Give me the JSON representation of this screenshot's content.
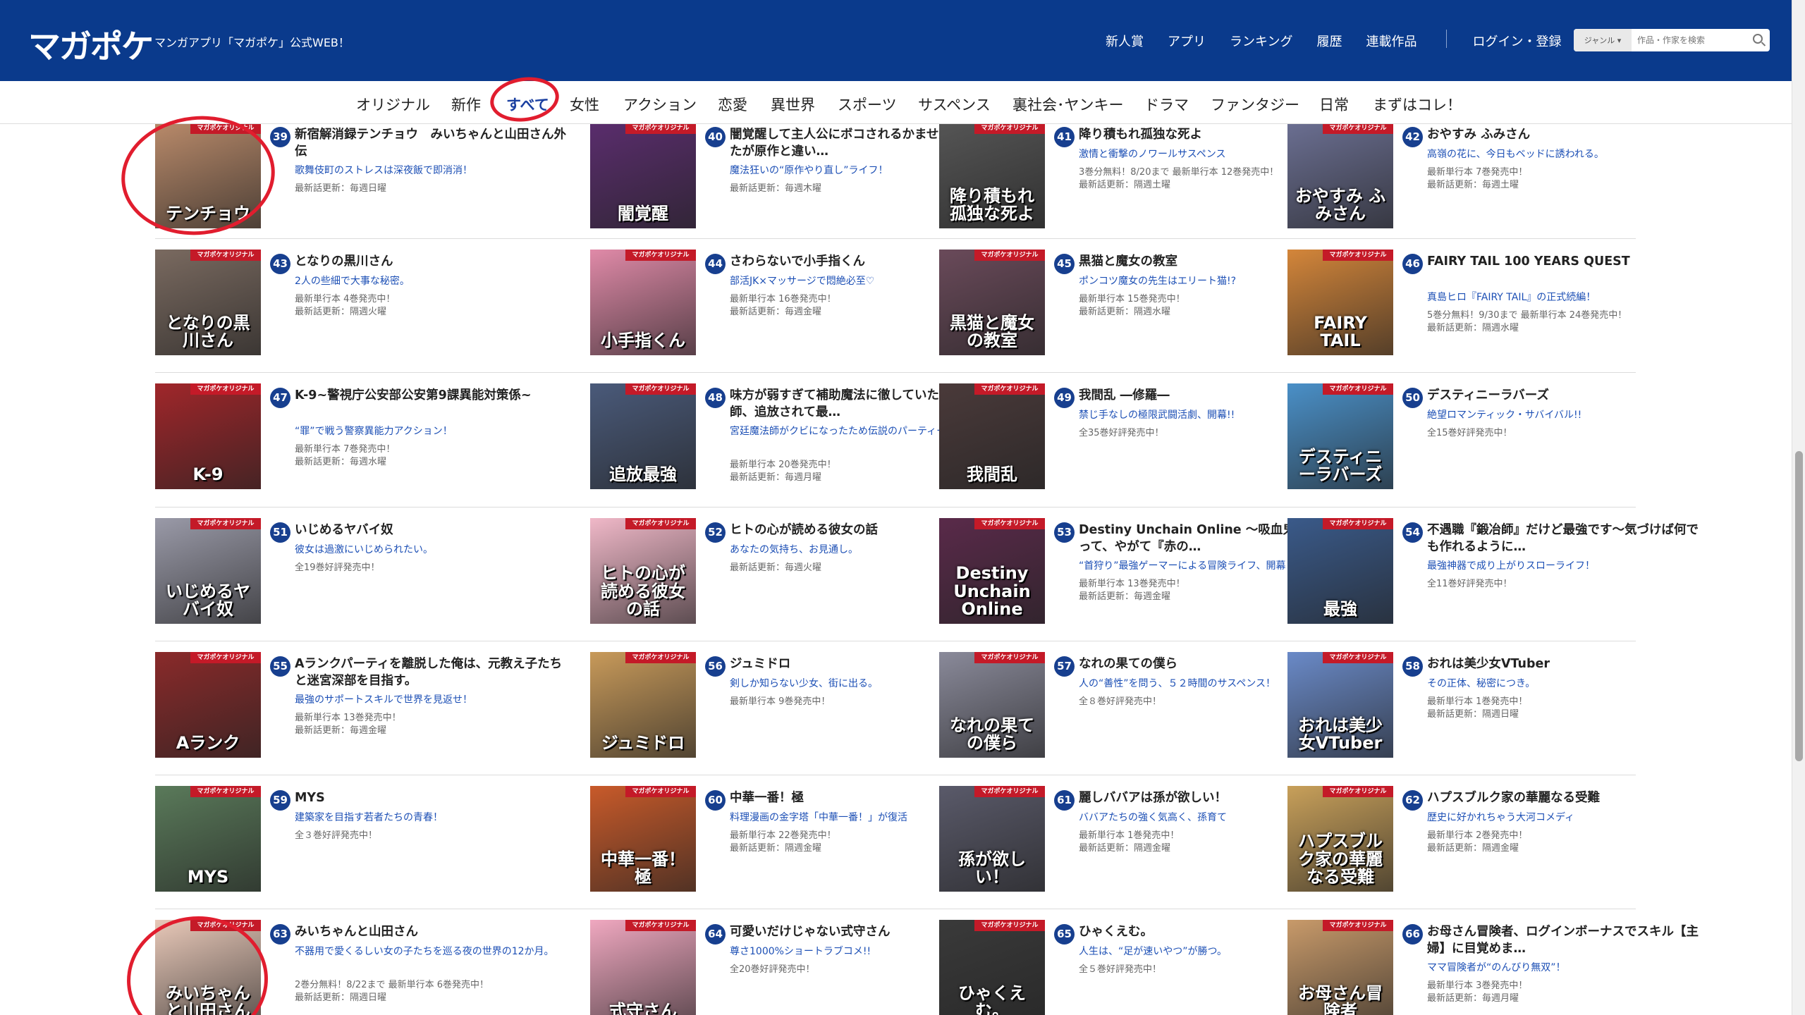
{
  "header": {
    "logo": "マガポケ",
    "tagline": "マンガアプリ「マガポケ」公式WEB！",
    "nav": [
      "新人賞",
      "アプリ",
      "ランキング",
      "履歴",
      "連載作品"
    ],
    "login": "ログイン・登録",
    "genre_select": "ジャンル ▾",
    "search_placeholder": "作品・作家を検索"
  },
  "tabs": {
    "items": [
      "オリジナル",
      "新作",
      "すべて",
      "女性",
      "アクション",
      "恋愛",
      "異世界",
      "スポーツ",
      "サスペンス",
      "裏社会･ヤンキー",
      "ドラマ",
      "ファンタジー",
      "日常",
      "まずはコレ！"
    ],
    "active": "すべて"
  },
  "thumb_band": "マガポケオリジナル",
  "items": [
    {
      "rank": "39",
      "title": "新宿解消録テンチョウ　みいちゃんと山田さん外伝",
      "desc": "歌舞伎町のストレスは深夜飯で即消消！",
      "info": [
        "最新話更新：毎週日曜"
      ],
      "thumb": "テンチョウ",
      "color": "#b98a6a"
    },
    {
      "rank": "40",
      "title": "闇覚醒して主人公にボコされるかませ犬に憑依したが原作と違い…",
      "desc": "魔法狂いの“原作やり直し”ライフ！",
      "info": [
        "最新話更新：毎週木曜"
      ],
      "thumb": "闇覚醒",
      "color": "#5a2d6d"
    },
    {
      "rank": "41",
      "title": "降り積もれ孤独な死よ",
      "desc": "激情と衝撃のノワールサスペンス",
      "info": [
        "3巻分無料！8/20まで 最新単行本 12巻発売中！",
        "最新話更新：隔週土曜"
      ],
      "thumb": "降り積もれ孤独な死よ",
      "color": "#555"
    },
    {
      "rank": "42",
      "title": "おやすみ ふみさん",
      "desc": "高嶺の花に、今日もベッドに誘われる。",
      "info": [
        "最新単行本 7巻発売中！",
        "最新話更新：毎週土曜"
      ],
      "thumb": "おやすみ ふみさん",
      "color": "#6b6f92"
    },
    {
      "rank": "43",
      "title": "となりの黒川さん",
      "desc": "2人の些細で大事な秘密。",
      "info": [
        "最新単行本 4巻発売中！",
        "最新話更新：隔週火曜"
      ],
      "thumb": "となりの黒川さん",
      "color": "#7a6a60"
    },
    {
      "rank": "44",
      "title": "さわらないで小手指くん",
      "desc": "部活JK×マッサージで悶絶必至♡",
      "info": [
        "最新単行本 16巻発売中！",
        "最新話更新：毎週金曜"
      ],
      "thumb": "小手指くん",
      "color": "#e08aa8"
    },
    {
      "rank": "45",
      "title": "黒猫と魔女の教室",
      "desc": "ポンコツ魔女の先生はエリート猫!?",
      "info": [
        "最新単行本 15巻発売中！",
        "最新話更新：隔週水曜"
      ],
      "thumb": "黒猫と魔女の教室",
      "color": "#6a4a5a"
    },
    {
      "rank": "46",
      "title": "FAIRY TAIL 100 YEARS QUEST",
      "desc": "真島ヒロ『FAIRY TAIL』の正式続編！",
      "info": [
        "5巻分無料！9/30まで 最新単行本 24巻発売中！",
        "最新話更新：隔週水曜"
      ],
      "thumb": "FAIRY TAIL",
      "color": "#d4863a"
    },
    {
      "rank": "47",
      "title": "K-9~警視庁公安部公安第9課異能対策係~",
      "desc": "“罪”で戦う警察異能力アクション！",
      "info": [
        "最新単行本 7巻発売中！",
        "最新話更新：毎週水曜"
      ],
      "thumb": "K-9",
      "color": "#a0262a"
    },
    {
      "rank": "48",
      "title": "味方が弱すぎて補助魔法に徹していた宮廷魔法師、追放されて最…",
      "desc": "宮廷魔法師がクビになったため伝説のパーティー復活!!",
      "info": [
        "最新単行本 20巻発売中！",
        "最新話更新：毎週月曜"
      ],
      "thumb": "追放最強",
      "color": "#4a5a7a"
    },
    {
      "rank": "49",
      "title": "我間乱 ―修羅―",
      "desc": "禁じ手なしの極限武闘活劇、開幕!!",
      "info": [
        "全35巻好評発売中！"
      ],
      "thumb": "我間乱",
      "color": "#4a3a3a"
    },
    {
      "rank": "50",
      "title": "デスティニーラバーズ",
      "desc": "絶望ロマンティック・サバイバル!!",
      "info": [
        "全15巻好評発売中！"
      ],
      "thumb": "デスティニーラバーズ",
      "color": "#4a90c8"
    },
    {
      "rank": "51",
      "title": "いじめるヤバイ奴",
      "desc": "彼女は過激にいじめられたい。",
      "info": [
        "全19巻好評発売中！"
      ],
      "thumb": "いじめるヤバイ奴",
      "color": "#9a9aa8"
    },
    {
      "rank": "52",
      "title": "ヒトの心が読める彼女の話",
      "desc": "あなたの気持ち、お見通し。",
      "info": [
        "最新話更新：毎週火曜"
      ],
      "thumb": "ヒトの心が読める彼女の話",
      "color": "#f0b8c8"
    },
    {
      "rank": "53",
      "title": "Destiny Unchain Online 〜吸血鬼少女となって、やがて『赤の…",
      "desc": "“首狩り”最強ゲーマーによる冒険ライフ、開幕！",
      "info": [
        "最新単行本 13巻発売中！",
        "最新話更新：毎週金曜"
      ],
      "thumb": "Destiny Unchain Online",
      "color": "#5a2a4a"
    },
    {
      "rank": "54",
      "title": "不遇職『鍛冶師』だけど最強です〜気づけば何でも作れるように…",
      "desc": "最強神器で成り上がりスローライフ！",
      "info": [
        "全11巻好評発売中！"
      ],
      "thumb": "最強",
      "color": "#3a5a8a"
    },
    {
      "rank": "55",
      "title": "Aランクパーティを離脱した俺は、元教え子たちと迷宮深部を目指す。",
      "desc": "最強のサポートスキルで世界を見返せ！",
      "info": [
        "最新単行本 13巻発売中！",
        "最新話更新：毎週金曜"
      ],
      "thumb": "Aランク",
      "color": "#8a2a2a"
    },
    {
      "rank": "56",
      "title": "ジュミドロ",
      "desc": "剣しか知らない少女、街に出る。",
      "info": [
        "最新単行本 9巻発売中！"
      ],
      "thumb": "ジュミドロ",
      "color": "#c89a5a"
    },
    {
      "rank": "57",
      "title": "なれの果ての僕ら",
      "desc": "人の“善性”を問う、５２時間のサスペンス！",
      "info": [
        "全８巻好評発売中！"
      ],
      "thumb": "なれの果ての僕ら",
      "color": "#8a8a9a"
    },
    {
      "rank": "58",
      "title": "おれは美少女VTuber",
      "desc": "その正体、秘密につき。",
      "info": [
        "最新単行本 1巻発売中！",
        "最新話更新：隔週日曜"
      ],
      "thumb": "おれは美少女VTuber",
      "color": "#6a8ac8"
    },
    {
      "rank": "59",
      "title": "MYS",
      "desc": "建築家を目指す若者たちの青春！",
      "info": [
        "全３巻好評発売中！"
      ],
      "thumb": "MYS",
      "color": "#5a7a5a"
    },
    {
      "rank": "60",
      "title": "中華一番！極",
      "desc": "料理漫画の金字塔「中華一番！」が復活",
      "info": [
        "最新単行本 22巻発売中！",
        "最新話更新：隔週金曜"
      ],
      "thumb": "中華一番！極",
      "color": "#c85a2a"
    },
    {
      "rank": "61",
      "title": "麗しババアは孫が欲しい！",
      "desc": "ババアたちの強く気高く、孫育て",
      "info": [
        "最新単行本 1巻発売中！",
        "最新話更新：隔週金曜"
      ],
      "thumb": "孫が欲しい！",
      "color": "#5a5a6a"
    },
    {
      "rank": "62",
      "title": "ハプスブルク家の華麗なる受難",
      "desc": "歴史に好かれちゃう大河コメディ",
      "info": [
        "最新単行本 2巻発売中！",
        "最新話更新：隔週金曜"
      ],
      "thumb": "ハプスブルク家の華麗なる受難",
      "color": "#c8a05a"
    },
    {
      "rank": "63",
      "title": "みいちゃんと山田さん",
      "desc": "不器用で愛くるしい女の子たちを巡る夜の世界の12か月。",
      "info": [
        "2巻分無料！8/22まで 最新単行本 6巻発売中！",
        "最新話更新：隔週日曜"
      ],
      "thumb": "みいちゃんと山田さん",
      "color": "#e8c8b8"
    },
    {
      "rank": "64",
      "title": "可愛いだけじゃない式守さん",
      "desc": "尊さ1000%ショートラブコメ!!",
      "info": [
        "全20巻好評発売中！"
      ],
      "thumb": "式守さん",
      "color": "#f0a8c0"
    },
    {
      "rank": "65",
      "title": "ひゃくえむ。",
      "desc": "人生は、“足が速いやつ”が勝つ。",
      "info": [
        "全５巻好評発売中！"
      ],
      "thumb": "ひゃくえむ。",
      "color": "#3a3a3a"
    },
    {
      "rank": "66",
      "title": "お母さん冒険者、ログインボーナスでスキル【主婦】に目覚めま…",
      "desc": "ママ冒険者が“のんびり無双”！",
      "info": [
        "最新単行本 3巻発売中！",
        "最新話更新：毎週月曜"
      ],
      "thumb": "お母さん冒険者",
      "color": "#c89a6a"
    }
  ]
}
